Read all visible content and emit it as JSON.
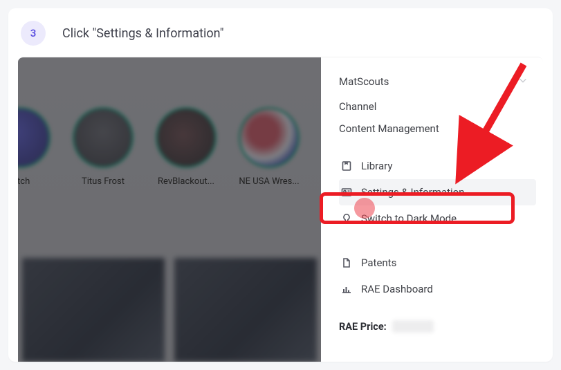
{
  "step": {
    "number": "3",
    "title": "Click \"Settings & Information\""
  },
  "avatars": [
    {
      "label": "Fitch"
    },
    {
      "label": "Titus Frost"
    },
    {
      "label": "RevBlackout..."
    },
    {
      "label": "NE USA Wres..."
    }
  ],
  "panel": {
    "workspace": "MatScouts",
    "section1": "Channel",
    "section2": "Content Management",
    "menu": {
      "library": "Library",
      "settings": "Settings & Information",
      "darkmode": "Switch to Dark Mode",
      "patents": "Patents",
      "dashboard": "RAE Dashboard"
    },
    "price_label": "RAE Price:"
  },
  "annotation": {
    "highlight_color": "#ec1c24"
  }
}
